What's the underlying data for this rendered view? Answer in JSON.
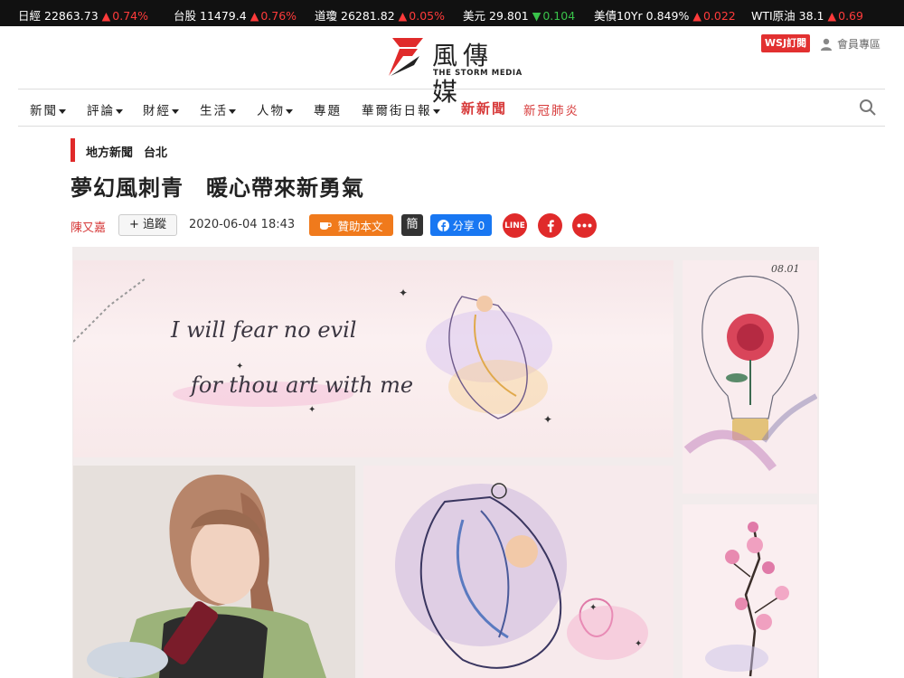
{
  "ticker": [
    {
      "name": "日經",
      "value": "22863.73",
      "dir": "up",
      "change": "0.74%"
    },
    {
      "name": "台股",
      "value": "11479.4",
      "dir": "up",
      "change": "0.76%"
    },
    {
      "name": "道瓊",
      "value": "26281.82",
      "dir": "up",
      "change": "0.05%"
    },
    {
      "name": "美元",
      "value": "29.801",
      "dir": "down",
      "change": "0.104"
    },
    {
      "name": "美債10Yr",
      "value": "0.849%",
      "dir": "up",
      "change": "0.022"
    },
    {
      "name": "WTI原油",
      "value": "38.1",
      "dir": "up",
      "change": "0.69"
    }
  ],
  "header": {
    "logo_cn": "風傳媒",
    "logo_en": "THE STORM MEDIA",
    "wsj_button": "WSJ訂閱",
    "member_label": "會員專區"
  },
  "nav": [
    {
      "label": "新聞",
      "dropdown": true
    },
    {
      "label": "評論",
      "dropdown": true
    },
    {
      "label": "財經",
      "dropdown": true
    },
    {
      "label": "生活",
      "dropdown": true
    },
    {
      "label": "人物",
      "dropdown": true
    },
    {
      "label": "專題",
      "dropdown": false
    },
    {
      "label": "華爾街日報",
      "dropdown": true
    },
    {
      "label": "新新聞",
      "dropdown": false
    },
    {
      "label": "新冠肺炎",
      "dropdown": false
    }
  ],
  "article": {
    "categories": [
      "地方新聞",
      "台北"
    ],
    "title": "夢幻風刺青　暖心帶來新勇氣",
    "author": "陳又嘉",
    "follow_label": "+ 追蹤",
    "date": "2020-06-04 18:43",
    "sponsor_label": "贊助本文",
    "simplified_label": "簡",
    "share_label": "分享 0",
    "line_label": "LINE"
  },
  "photo": {
    "script_line1": "I will fear no evil",
    "script_line2": "for thou art with me",
    "bulb_date": "08.01"
  },
  "colors": {
    "accent_red": "#e02a2a",
    "sponsor_orange": "#f07a1c",
    "facebook_blue": "#1877f2",
    "ticker_up": "#ff3b3b",
    "ticker_down": "#39c24a"
  }
}
